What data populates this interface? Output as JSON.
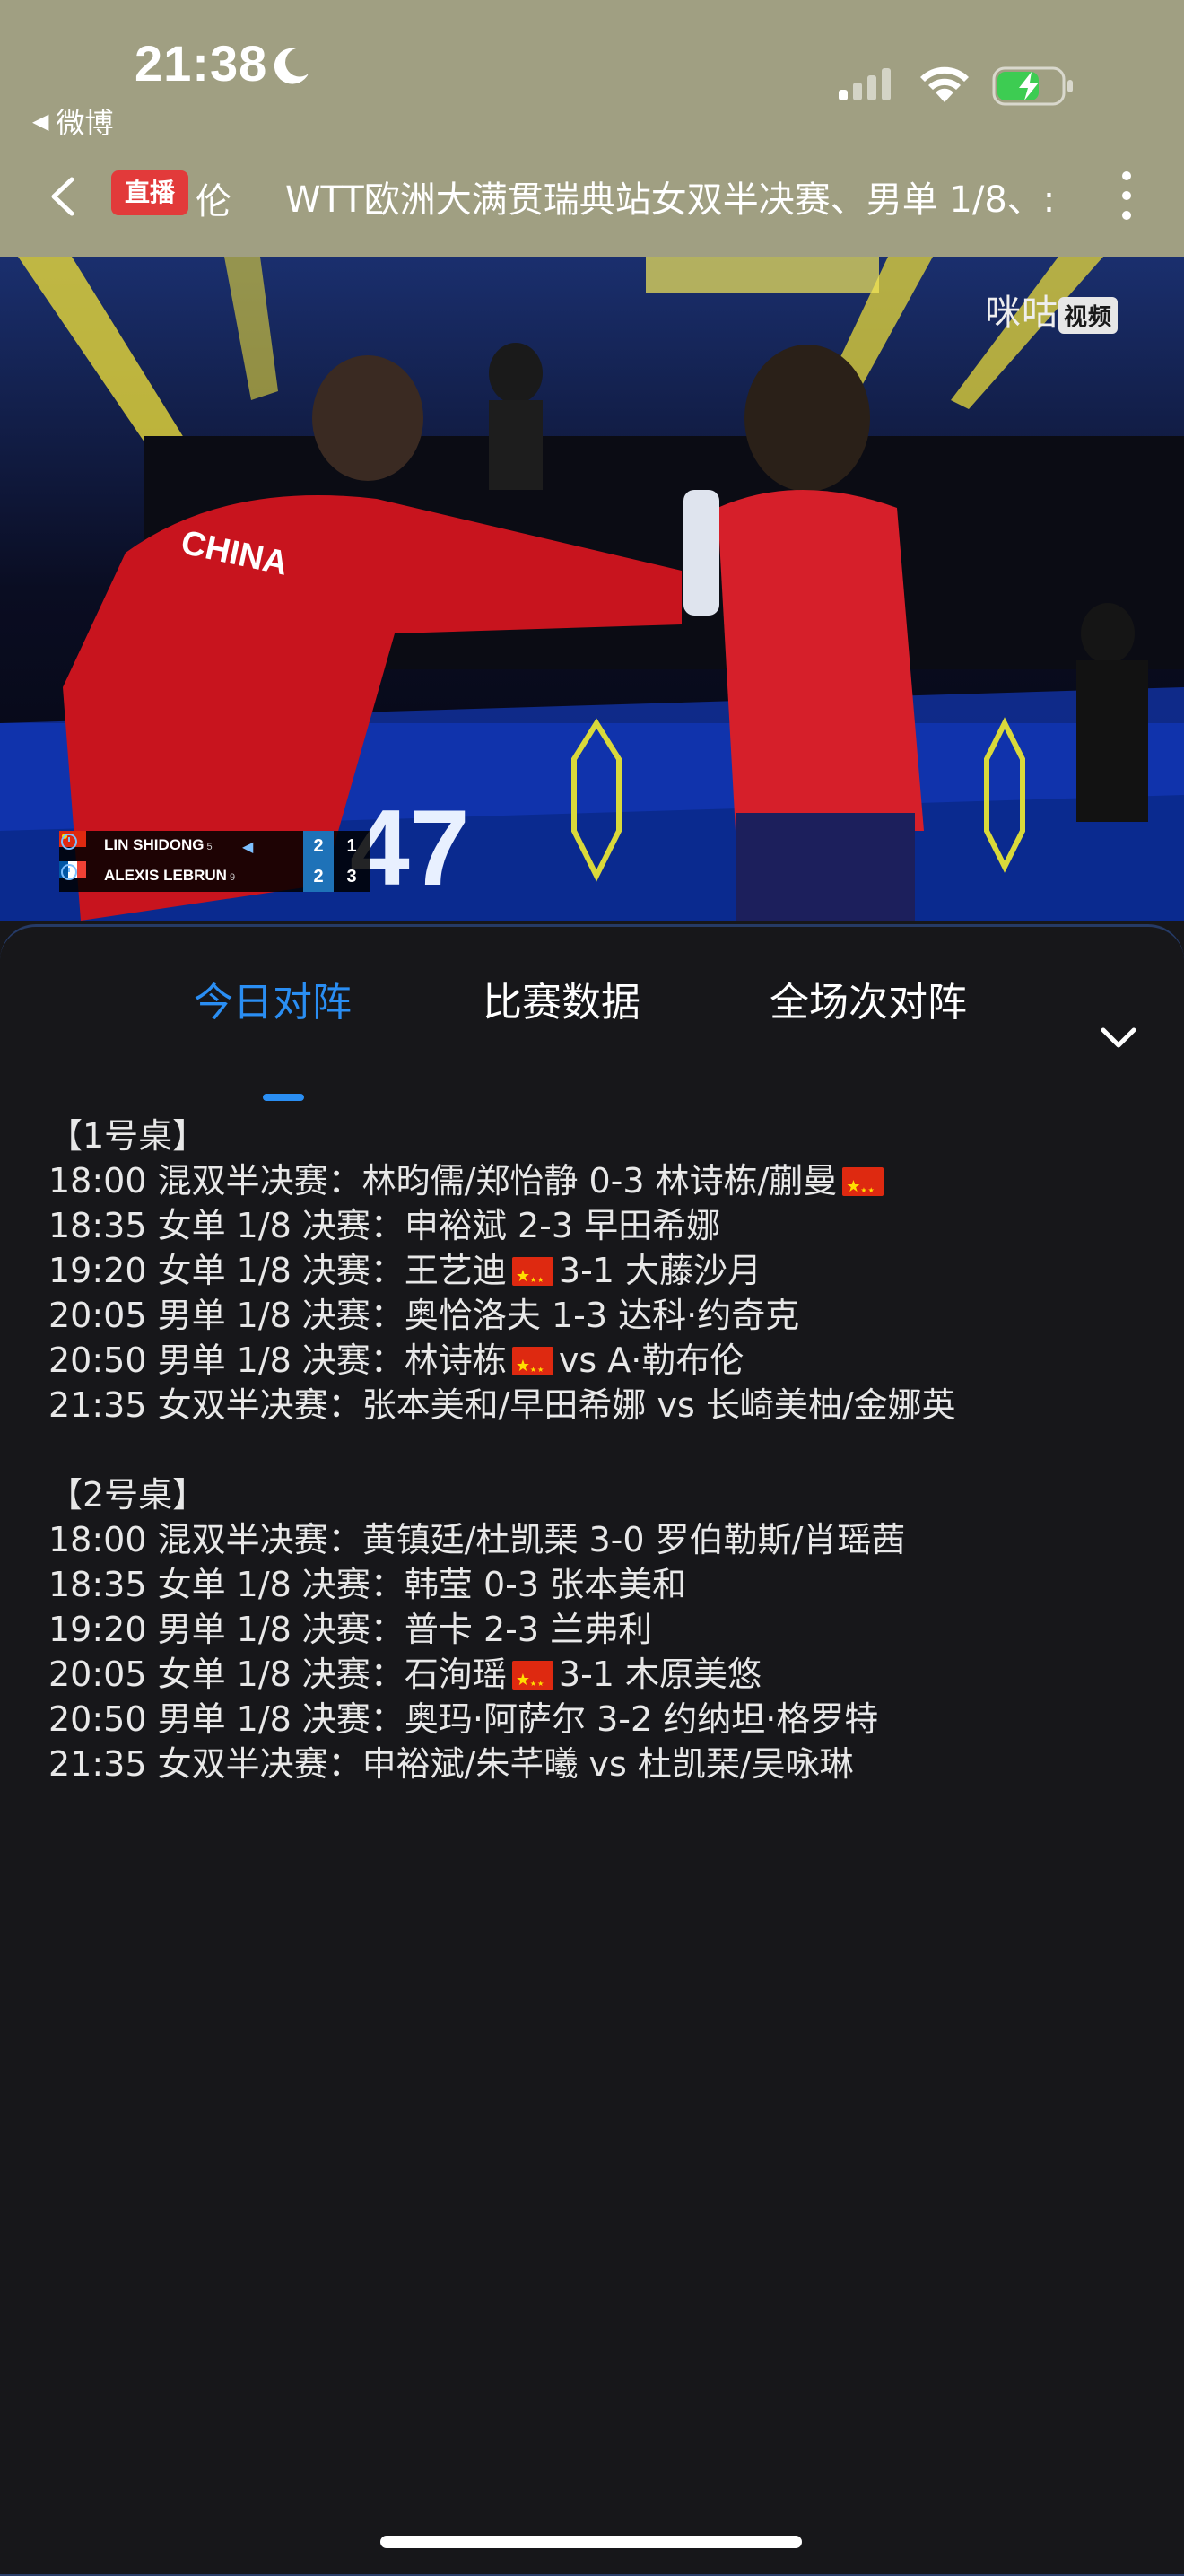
{
  "status_bar": {
    "time": "21:38",
    "back_app": "微博"
  },
  "nav": {
    "live_badge": "直播",
    "prefix": "伦",
    "title": "WTT欧洲大满贯瑞典站女双半决赛、男单 1/8、:"
  },
  "video": {
    "watermark": "咪咕",
    "watermark_tag": "视频",
    "scoreboard": [
      {
        "name": "LIN SHIDONG",
        "seed": "5",
        "games": "2",
        "points": "1",
        "serving": true
      },
      {
        "name": "ALEXIS LEBRUN",
        "seed": "9",
        "games": "2",
        "points": "3",
        "serving": false
      }
    ]
  },
  "tabs": [
    "今日对阵",
    "比赛数据",
    "全场次对阵"
  ],
  "active_tab": 0,
  "schedule": [
    {
      "table": "【1号桌】",
      "matches": [
        {
          "before": "18:00 混双半决赛：林昀儒/郑怡静 0-3 林诗栋/蒯曼",
          "flag": true,
          "after": ""
        },
        {
          "before": "18:35 女单 1/8 决赛：申裕斌 2-3 早田希娜",
          "flag": false,
          "after": ""
        },
        {
          "before": "19:20 女单 1/8 决赛：王艺迪",
          "flag": true,
          "after": "3-1 大藤沙月"
        },
        {
          "before": "20:05 男单 1/8 决赛：奥恰洛夫 1-3 达科·约奇克",
          "flag": false,
          "after": ""
        },
        {
          "before": "20:50 男单 1/8 决赛：林诗栋",
          "flag": true,
          "after": "vs A·勒布伦"
        },
        {
          "before": "21:35 女双半决赛：张本美和/早田希娜 vs 长崎美柚/金娜英",
          "flag": false,
          "after": ""
        }
      ]
    },
    {
      "table": "【2号桌】",
      "matches": [
        {
          "before": "18:00 混双半决赛：黄镇廷/杜凯琹 3-0 罗伯勒斯/肖瑶茜",
          "flag": false,
          "after": ""
        },
        {
          "before": "18:35 女单 1/8 决赛：韩莹 0-3 张本美和",
          "flag": false,
          "after": ""
        },
        {
          "before": "19:20 男单 1/8 决赛：普卡 2-3 兰弗利",
          "flag": false,
          "after": ""
        },
        {
          "before": "20:05 女单 1/8 决赛：石洵瑶",
          "flag": true,
          "after": "3-1 木原美悠"
        },
        {
          "before": "20:50 男单 1/8 决赛：奥玛·阿萨尔 3-2 约纳坦·格罗特",
          "flag": false,
          "after": ""
        },
        {
          "before": "21:35 女双半决赛：申裕斌/朱芊曦 vs 杜凯琹/吴咏琳",
          "flag": false,
          "after": ""
        }
      ]
    }
  ],
  "colors": {
    "accent": "#2a8ef3",
    "live_red": "#e23a3a",
    "header_bg": "#a09f82",
    "panel_bg": "#17171a"
  }
}
